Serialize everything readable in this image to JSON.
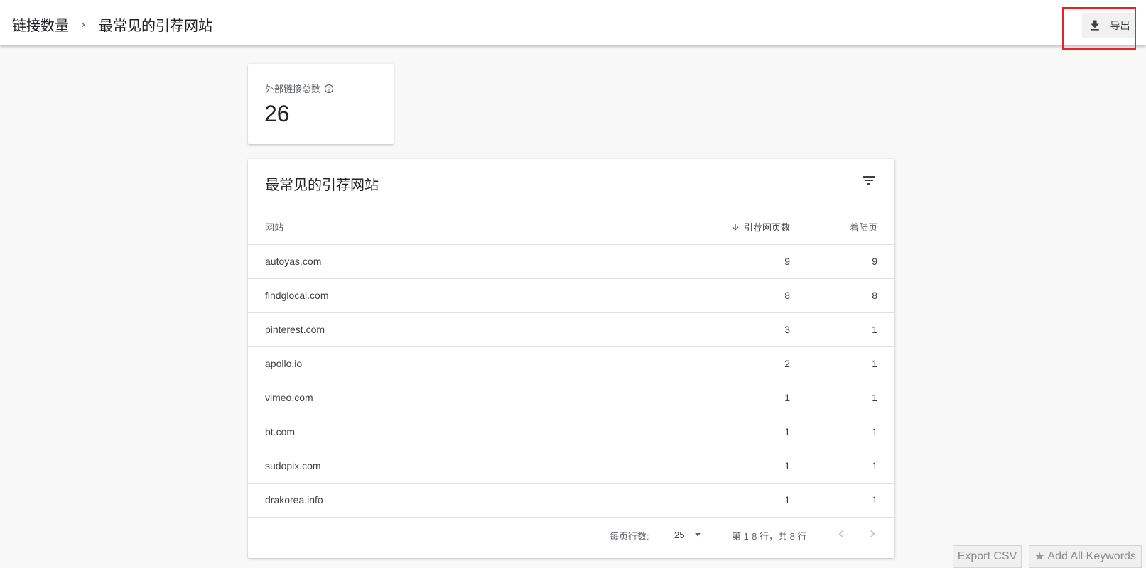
{
  "header": {
    "breadcrumb_parent": "链接数量",
    "breadcrumb_current": "最常见的引荐网站",
    "export_label": "导出"
  },
  "summary": {
    "label": "外部链接总数",
    "value": "26"
  },
  "table": {
    "title": "最常见的引荐网站",
    "columns": {
      "site": "网站",
      "referring_pages": "引荐网页数",
      "landing_pages": "着陆页"
    },
    "sort": {
      "column": "referring_pages",
      "direction": "descending"
    },
    "rows": [
      {
        "site": "autoyas.com",
        "referring_pages": "9",
        "landing_pages": "9"
      },
      {
        "site": "findglocal.com",
        "referring_pages": "8",
        "landing_pages": "8"
      },
      {
        "site": "pinterest.com",
        "referring_pages": "3",
        "landing_pages": "1"
      },
      {
        "site": "apollo.io",
        "referring_pages": "2",
        "landing_pages": "1"
      },
      {
        "site": "vimeo.com",
        "referring_pages": "1",
        "landing_pages": "1"
      },
      {
        "site": "bt.com",
        "referring_pages": "1",
        "landing_pages": "1"
      },
      {
        "site": "sudopix.com",
        "referring_pages": "1",
        "landing_pages": "1"
      },
      {
        "site": "drakorea.info",
        "referring_pages": "1",
        "landing_pages": "1"
      }
    ]
  },
  "pagination": {
    "rows_per_page_label": "每页行数:",
    "rows_per_page_value": "25",
    "range_text": "第 1-8 行，共 8 行"
  },
  "floating_buttons": {
    "export_csv": "Export CSV",
    "add_all_keywords": "Add All Keywords"
  },
  "icons": {
    "breadcrumb_separator": "chevron-right-icon",
    "export": "download-icon",
    "help": "help-circle-icon",
    "filter": "filter-list-icon",
    "sort": "arrow-down-icon",
    "dropdown": "caret-down-icon",
    "prev": "chevron-left-icon",
    "next": "chevron-right-icon",
    "star": "star-icon"
  },
  "colors": {
    "highlight_box": "#e8202a",
    "background": "#f8f8f8",
    "card": "#ffffff"
  }
}
